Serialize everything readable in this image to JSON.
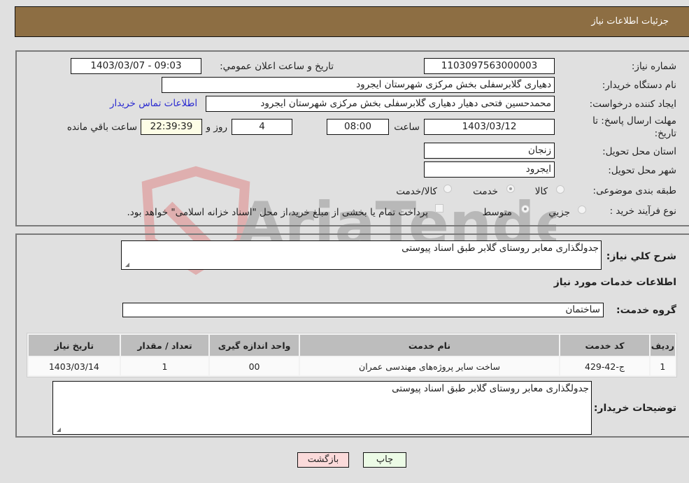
{
  "header": {
    "title": "جزئیات اطلاعات نیاز"
  },
  "form": {
    "need_number": {
      "label": "شماره نیاز:",
      "value": "1103097563000003"
    },
    "announce_datetime": {
      "label": "تاریخ و ساعت اعلان عمومي:",
      "value": "1403/03/07 - 09:03"
    },
    "buyer_org": {
      "label": "نام دستگاه خریدار:",
      "value": "دهیاری گلابرسفلی بخش مرکزی شهرستان ایجرود"
    },
    "requester": {
      "label": "ایجاد کننده درخواست:",
      "value": "محمدحسین فتحی دهیار دهیاری گلابرسفلی بخش مرکزی شهرستان ایجرود"
    },
    "contact_link": "اطلاعات تماس خریدار",
    "deadline": {
      "label_line1": "مهلت ارسال پاسخ: تا",
      "label_line2": "تاریخ:",
      "date": "1403/03/12",
      "time_label": "ساعت",
      "time": "08:00",
      "days": "4",
      "days_label": "روز و",
      "remaining": "22:39:39",
      "remaining_label": "ساعت باقي مانده"
    },
    "province": {
      "label": "استان محل تحویل:",
      "value": "زنجان"
    },
    "city": {
      "label": "شهر محل تحویل:",
      "value": "ایجرود"
    },
    "category": {
      "label": "طبقه بندی موضوعی:",
      "options": [
        "کالا",
        "خدمت",
        "کالا/خدمت"
      ],
      "selected": "خدمت"
    },
    "process": {
      "label": "نوع فرآیند خرید :",
      "options": [
        "جزيي",
        "متوسط"
      ],
      "selected": "متوسط",
      "treasury_note": "پرداخت تمام یا بخشی از مبلغ خرید،از محل \"اسناد خزانه اسلامی\" خواهد بود."
    }
  },
  "details": {
    "summary_label": "شرح کلي نياز:",
    "summary_value": "جدولگذاری معابر روستای گلابر طبق اسناد پیوستی",
    "services_heading": "اطلاعات خدمات مورد نياز",
    "service_group_label": "گروه خدمت:",
    "service_group_value": "ساختمان",
    "table": {
      "headers": [
        "ردیف",
        "کد خدمت",
        "نام خدمت",
        "واحد اندازه گیری",
        "تعداد / مقدار",
        "تاریخ نیاز"
      ],
      "rows": [
        [
          "1",
          "ج-42-429",
          "ساخت سایر پروژه‌های مهندسی عمران",
          "00",
          "1",
          "1403/03/14"
        ]
      ]
    },
    "buyer_notes_label": "توضیحات خریدار:",
    "buyer_notes_value": "جدولگذاری معابر روستای گلابر طبق اسناد پیوستی"
  },
  "buttons": {
    "print": "چاپ",
    "back": "بازگشت"
  },
  "watermark": {
    "text": "AriaTender.neT"
  }
}
